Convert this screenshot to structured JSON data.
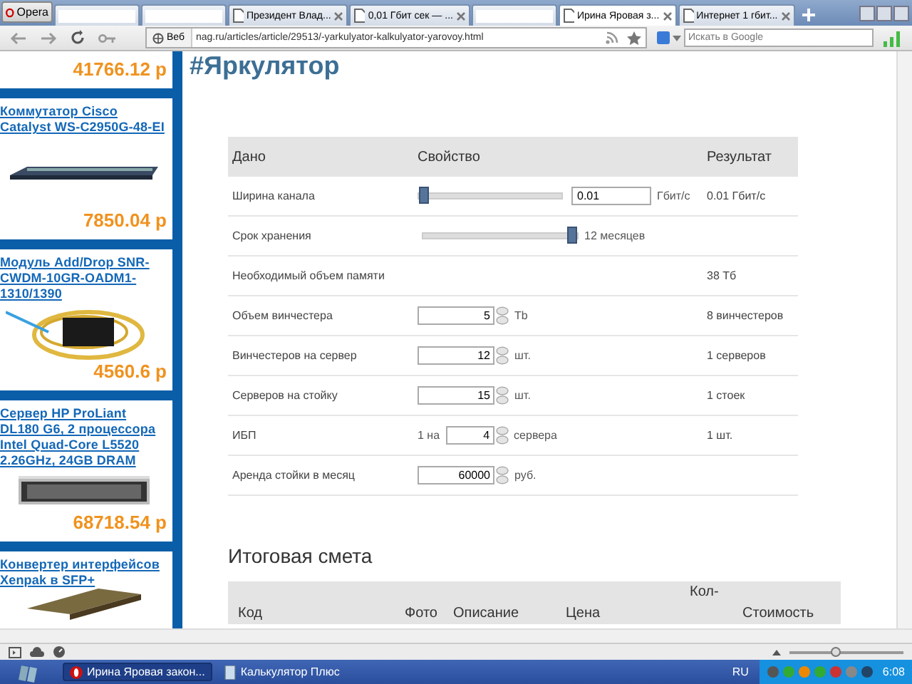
{
  "browser": {
    "menu_button": "Opera",
    "tabs": [
      {
        "kind": "redacted",
        "selected": false
      },
      {
        "kind": "redacted",
        "selected": false
      },
      {
        "kind": "page",
        "label": "Президент Влад...",
        "selected": false
      },
      {
        "kind": "page",
        "label": "0,01 Гбит сек — ...",
        "selected": false
      },
      {
        "kind": "redacted",
        "selected": false
      },
      {
        "kind": "page",
        "label": "Ирина Яровая з...",
        "selected": true
      },
      {
        "kind": "page",
        "label": "Интернет 1 гбит...",
        "selected": false
      }
    ],
    "address_badge": "Веб",
    "url": "nag.ru/articles/article/29513/-yarkulyator-kalkulyator-yarovoy.html",
    "search": {
      "placeholder": "Искать в Google"
    }
  },
  "sidebar": {
    "products": [
      {
        "price": "41766.12 р"
      },
      {
        "title": "Коммутатор Cisco Catalyst WS-C2950G-48-EI",
        "kind": "switch",
        "price": "7850.04 р"
      },
      {
        "title": "Модуль Add/Drop SNR-CWDM-10GR-OADM1-1310/1390",
        "kind": "module",
        "price": "4560.6 р"
      },
      {
        "title": "Сервер HP ProLiant DL180 G6, 2 процессора Intel Quad-Core L5520 2.26GHz, 24GB DRAM",
        "kind": "server",
        "price": "68718.54 р"
      },
      {
        "title": "Конвертер интерфейсов Xenpak в SFP+",
        "kind": "converter"
      }
    ]
  },
  "page_title": "#Яркулятор",
  "calculator": {
    "columns": [
      "Дано",
      "Свойство",
      "Результат"
    ],
    "rows": [
      {
        "label": "Ширина канала",
        "kind": "slider_input",
        "level": 0,
        "value": "0.01",
        "unit": "Гбит/с",
        "result": "0.01 Гбит/с"
      },
      {
        "label": "Срок хранения",
        "kind": "slider",
        "level": 1,
        "reading": "12 месяцев"
      },
      {
        "label": "Необходимый объем памяти",
        "kind": "text",
        "result": "38 Тб"
      },
      {
        "label": "Объем винчестера",
        "kind": "spin",
        "value": "5",
        "unit": "Tb",
        "result": "8 винчестеров"
      },
      {
        "label": "Винчестеров на сервер",
        "kind": "spin",
        "value": "12",
        "unit": "шт.",
        "result": "1 серверов"
      },
      {
        "label": "Серверов на стойку",
        "kind": "spin",
        "value": "15",
        "unit": "шт.",
        "result": "1 стоек"
      },
      {
        "label": "ИБП",
        "kind": "spin",
        "prefix": "1 на",
        "value": "4",
        "unit": "сервера",
        "result": "1 шт."
      },
      {
        "label": "Аренда стойки в месяц",
        "kind": "spin",
        "value": "60000",
        "unit": "руб."
      }
    ]
  },
  "estimate": {
    "title": "Итоговая смета",
    "columns": [
      "Код",
      "Фото",
      "Описание",
      "Цена",
      "Кол-",
      "Стоимость"
    ]
  },
  "status_bar": {
    "zoom": {
      "level": 0.4
    }
  },
  "taskbar": {
    "tasks": [
      {
        "label": "Ирина Яровая закон...",
        "selected": true
      },
      {
        "label": "Калькулятор Плюс",
        "selected": false
      }
    ],
    "language": "RU",
    "clock": "6:08"
  }
}
